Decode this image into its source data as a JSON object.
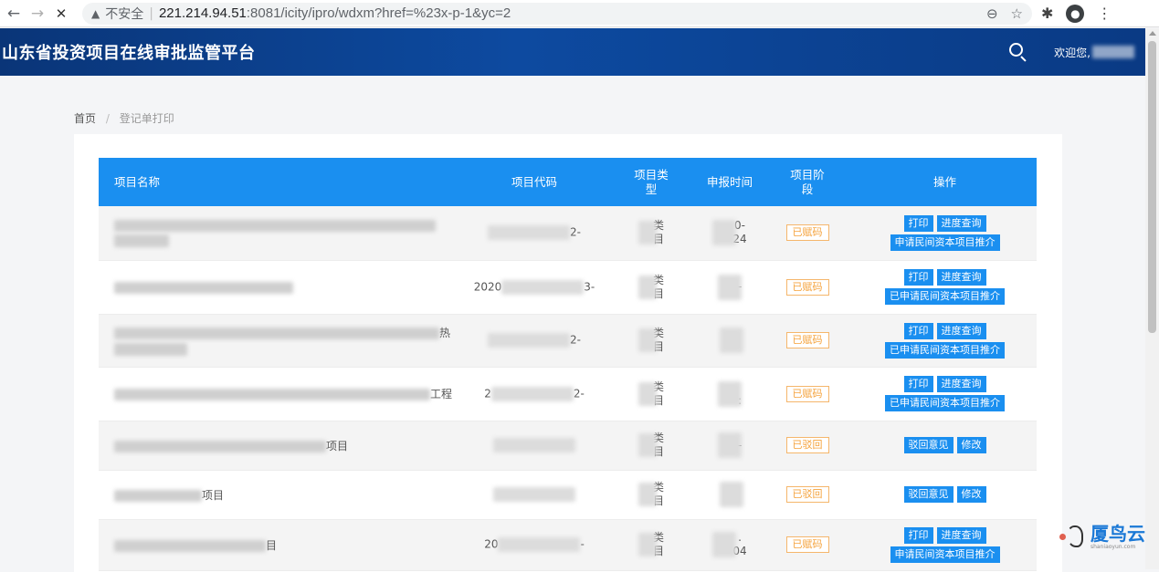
{
  "browser": {
    "back_icon": "←",
    "forward_icon": "→",
    "stop_icon": "✕",
    "warning_icon": "▲",
    "insecure_label": "不安全",
    "url_host": "221.214.94.51",
    "url_rest": ":8081/icity/ipro/wdxm?href=%23x-p-1&yc=2",
    "zoom_icon": "⊖",
    "star_icon": "☆",
    "extension_icon": "✱",
    "profile_icon": "●",
    "menu_icon": "⋮"
  },
  "header": {
    "title": "山东省投资项目在线审批监管平台",
    "welcome": "欢迎您,"
  },
  "breadcrumb": {
    "home": "首页",
    "separator": "/",
    "current": "登记单打印"
  },
  "table": {
    "headers": {
      "name": "项目名称",
      "code": "项目代码",
      "type": "项目类型",
      "date": "申报时间",
      "stage": "项目阶段",
      "ops": "操作"
    },
    "rows": [
      {
        "name_suffix": "",
        "code_prefix": "",
        "code_suffix": "2-",
        "type_text": "类",
        "type_text2": "目",
        "date_text": "0-",
        "date_text2": "24",
        "stage": "已赋码",
        "btn1": "打印",
        "btn2": "进度查询",
        "btn3": "申请民间资本项目推介"
      },
      {
        "name_suffix": "",
        "code_prefix": "2020",
        "code_suffix": "3-",
        "type_text": "类",
        "type_text2": "目",
        "date_text": "-",
        "date_text2": "",
        "stage": "已赋码",
        "btn1": "打印",
        "btn2": "进度查询",
        "btn3": "已申请民间资本项目推介"
      },
      {
        "name_suffix": "热",
        "code_prefix": "",
        "code_suffix": "2-",
        "type_text": "类",
        "type_text2": "目",
        "date_text": "",
        "date_text2": "",
        "stage": "已赋码",
        "btn1": "打印",
        "btn2": "进度查询",
        "btn3": "已申请民间资本项目推介"
      },
      {
        "name_suffix": "工程",
        "code_prefix": "2",
        "code_suffix": "2-",
        "type_text": "类",
        "type_text2": "目",
        "date_text": "",
        "date_text2": ":",
        "stage": "已赋码",
        "btn1": "打印",
        "btn2": "进度查询",
        "btn3": "已申请民间资本项目推介"
      },
      {
        "name_suffix": "项目",
        "code_prefix": "",
        "code_suffix": "",
        "type_text": "类",
        "type_text2": "目",
        "date_text": "-",
        "date_text2": "",
        "stage": "已驳回",
        "btn1": "驳回意见",
        "btn2": "修改"
      },
      {
        "name_suffix": "项目",
        "code_prefix": "",
        "code_suffix": "",
        "type_text": "类",
        "type_text2": "目",
        "date_text": "",
        "date_text2": "",
        "stage": "已驳回",
        "btn1": "驳回意见",
        "btn2": "修改"
      },
      {
        "name_suffix": "目",
        "code_prefix": "20",
        "code_suffix": "-",
        "type_text": "类",
        "type_text2": "目",
        "date_text": ".",
        "date_text2": "04",
        "stage": "已赋码",
        "btn1": "打印",
        "btn2": "进度查询",
        "btn3": "申请民间资本项目推介"
      }
    ]
  },
  "watermark": {
    "title": "厦鸟云",
    "subtitle": "shaniaoyun.com"
  }
}
